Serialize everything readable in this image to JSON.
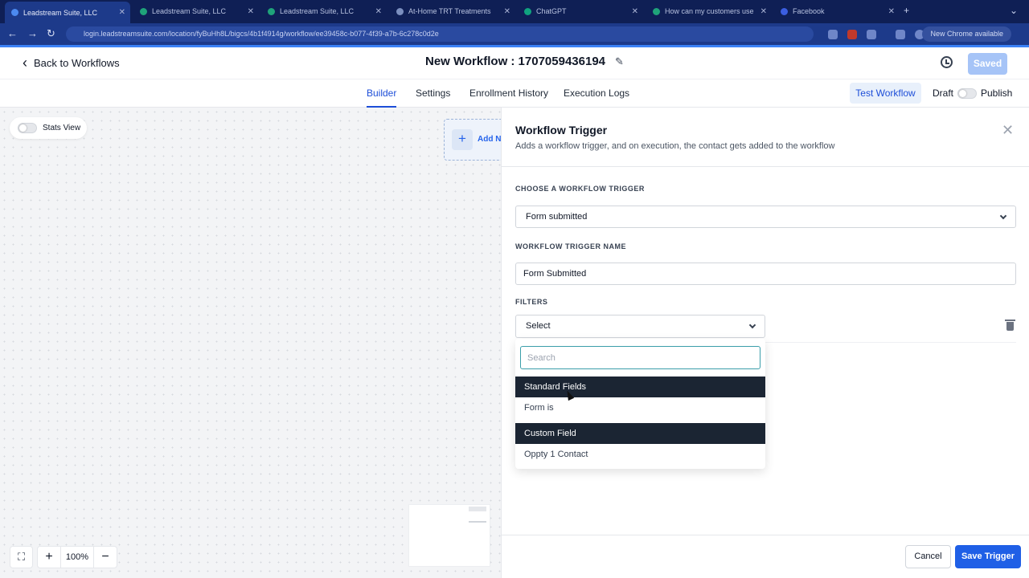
{
  "browser": {
    "tabs": [
      {
        "title": "Leadstream Suite, LLC",
        "active": true
      },
      {
        "title": "Leadstream Suite, LLC",
        "active": false
      },
      {
        "title": "Leadstream Suite, LLC",
        "active": false
      },
      {
        "title": "At-Home TRT Treatments",
        "active": false
      },
      {
        "title": "ChatGPT",
        "active": false
      },
      {
        "title": "How can my customers use",
        "active": false
      },
      {
        "title": "Facebook",
        "active": false
      }
    ],
    "url": "login.leadstreamsuite.com/location/fyBuHh8L/bigcs/4b1f4914g/workflow/ee39458c-b077-4f39-a7b-6c278c0d2e",
    "chrome_pill": "New Chrome available",
    "accent_color": "#3b82f6"
  },
  "header": {
    "back_label": "Back to Workflows",
    "title": "New Workflow : 1707059436194",
    "saved_label": "Saved"
  },
  "tabs": [
    {
      "label": "Builder",
      "active": true
    },
    {
      "label": "Settings",
      "active": false
    },
    {
      "label": "Enrollment History",
      "active": false
    },
    {
      "label": "Execution Logs",
      "active": false
    }
  ],
  "toolbar": {
    "test_label": "Test Workflow",
    "draft_label": "Draft",
    "publish_label": "Publish"
  },
  "canvas": {
    "stats_view_label": "Stats View",
    "add_trigger_label": "Add New Trigger",
    "zoom_value": "100%"
  },
  "panel": {
    "title": "Workflow Trigger",
    "subtitle": "Adds a workflow trigger, and on execution, the contact gets added to the workflow",
    "choose_label": "CHOOSE A WORKFLOW TRIGGER",
    "trigger_value": "Form submitted",
    "name_label": "WORKFLOW TRIGGER NAME",
    "name_value": "Form Submitted",
    "filters_label": "FILTERS",
    "filter_select_value": "Select",
    "search_placeholder": "Search",
    "dropdown": {
      "group1": "Standard Fields",
      "group1_option": "Form is",
      "group2": "Custom Field",
      "group2_option": "Oppty 1 Contact"
    },
    "cancel_label": "Cancel",
    "save_label": "Save Trigger"
  }
}
